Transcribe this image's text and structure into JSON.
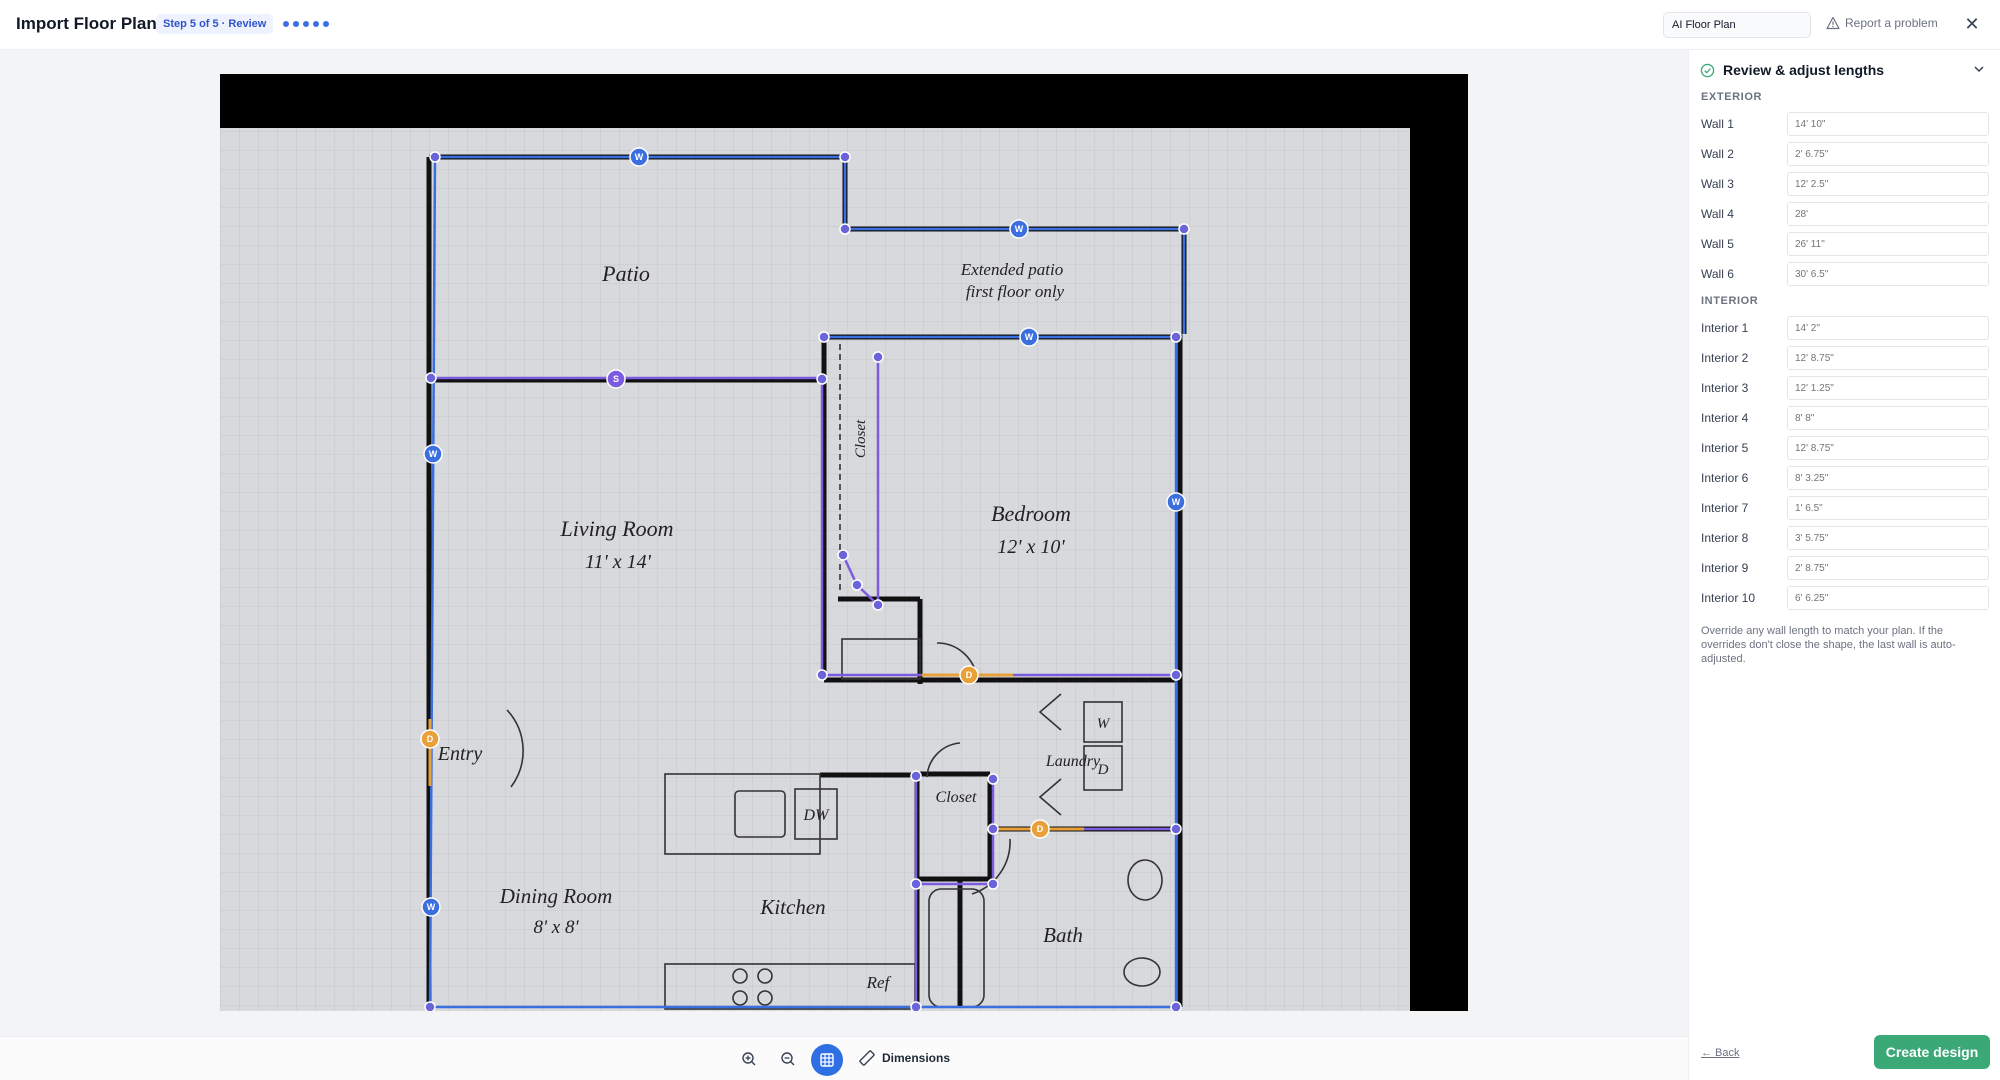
{
  "header": {
    "title": "Import Floor Plan",
    "step": "Step 5 of 5 · Review",
    "dots_count": 5,
    "name_input_value": "AI Floor Plan",
    "report_label": "Report a problem",
    "close_symbol": "✕"
  },
  "plan": {
    "rooms": {
      "patio": "Patio",
      "extended_patio_1": "Extended patio",
      "extended_patio_2": "first floor only",
      "living_room": "Living Room",
      "living_room_size": "11' x 14'",
      "bedroom": "Bedroom",
      "bedroom_size": "12' x 10'",
      "closet_1": "Closet",
      "closet_2": "Closet",
      "entry": "Entry",
      "laundry": "Laundry",
      "washer": "W",
      "dryer": "D",
      "dw": "DW",
      "dining_room": "Dining Room",
      "dining_room_size": "8' x 8'",
      "kitchen": "Kitchen",
      "bath": "Bath",
      "ref": "Ref"
    },
    "marker_labels": {
      "window": "W",
      "door": "D",
      "slider": "S"
    },
    "colors": {
      "wall_line": "#3b6fe0",
      "interior_line": "#7b5ce0",
      "door_line": "#e8a13a"
    }
  },
  "toolbar": {
    "icons": [
      "zoom-in-icon",
      "zoom-out-icon",
      "grid-icon",
      "ruler-icon"
    ],
    "dimensions_label": "Dimensions"
  },
  "panel": {
    "title": "Review & adjust lengths",
    "exterior_label": "EXTERIOR",
    "interior_label": "INTERIOR",
    "exterior": [
      {
        "label": "Wall 1",
        "value": "14' 10\""
      },
      {
        "label": "Wall 2",
        "value": "2' 6.75\""
      },
      {
        "label": "Wall 3",
        "value": "12' 2.5\""
      },
      {
        "label": "Wall 4",
        "value": "28'"
      },
      {
        "label": "Wall 5",
        "value": "26' 11\""
      },
      {
        "label": "Wall 6",
        "value": "30' 6.5\""
      }
    ],
    "interior": [
      {
        "label": "Interior 1",
        "value": "14' 2\""
      },
      {
        "label": "Interior 2",
        "value": "12' 8.75\""
      },
      {
        "label": "Interior 3",
        "value": "12' 1.25\""
      },
      {
        "label": "Interior 4",
        "value": "8' 8\""
      },
      {
        "label": "Interior 5",
        "value": "12' 8.75\""
      },
      {
        "label": "Interior 6",
        "value": "8' 3.25\""
      },
      {
        "label": "Interior 7",
        "value": "1' 6.5\""
      },
      {
        "label": "Interior 8",
        "value": "3' 5.75\""
      },
      {
        "label": "Interior 9",
        "value": "2' 8.75\""
      },
      {
        "label": "Interior 10",
        "value": "6' 6.25\""
      }
    ],
    "note": "Override any wall length to match your plan. If the overrides don't close the shape, the last wall is auto-adjusted.",
    "back_label": "← Back",
    "create_label": "Create design"
  }
}
